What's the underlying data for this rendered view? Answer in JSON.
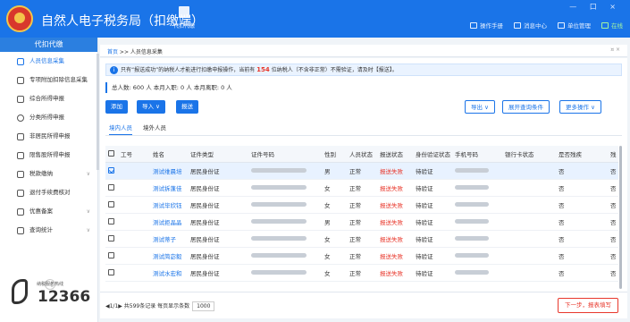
{
  "header": {
    "app_title": "自然人电子税务局（扣缴端）",
    "active_tab": "代扣代缴",
    "tools": [
      "操作手册",
      "消息中心",
      "单位管理",
      "在线"
    ],
    "window_controls": "— 口 ×"
  },
  "sidebar": {
    "header": "代扣代缴",
    "items": [
      {
        "label": "人员信息采集",
        "icon": "person-icon",
        "active": true,
        "chevron": ""
      },
      {
        "label": "专项附加扣除信息采集",
        "icon": "grid-icon",
        "active": false,
        "chevron": ""
      },
      {
        "label": "综合所得申报",
        "icon": "layers-icon",
        "active": false,
        "chevron": ""
      },
      {
        "label": "分类所得申报",
        "icon": "clock-icon",
        "active": false,
        "chevron": ""
      },
      {
        "label": "非居民所得申报",
        "icon": "user-icon",
        "active": false,
        "chevron": ""
      },
      {
        "label": "限售股所得申报",
        "icon": "bar-chart-icon",
        "active": false,
        "chevron": ""
      },
      {
        "label": "税款缴纳",
        "icon": "folder-icon",
        "active": false,
        "chevron": "∨"
      },
      {
        "label": "退付手续费核对",
        "icon": "table-icon",
        "active": false,
        "chevron": ""
      },
      {
        "label": "优惠备案",
        "icon": "file-icon",
        "active": false,
        "chevron": "∨"
      },
      {
        "label": "查询统计",
        "icon": "search-list-icon",
        "active": false,
        "chevron": "∨"
      }
    ],
    "collapse": "《",
    "hotline_title": "纳税服务热线",
    "hotline_number": "12366"
  },
  "tabbar": {
    "home": "首页",
    "sep": " >> ",
    "current": "人员信息采集",
    "close": "¤ ×"
  },
  "notice": {
    "icon": "i",
    "prefix": "只有“报送成功”的纳税人才能进行扣缴申报操作，当前有",
    "count": "154",
    "suffix": "位纳税人（不含非正常）不需验证，请及时【报送】。"
  },
  "stats": "总人数: 600 人   本月入职: 0 人   本月离职: 0 人",
  "buttons": {
    "add": "添加",
    "import": "导入 ∨",
    "submit": "报送",
    "export": "导出 ∨",
    "open_query": "展开查询条件",
    "more": "更多操作 ∨"
  },
  "subtabs": [
    "境内人员",
    "境外人员"
  ],
  "table": {
    "columns": [
      "",
      "工号",
      "姓名",
      "证件类型",
      "证件号码",
      "性别",
      "人员状态",
      "报送状态",
      "身份验证状态",
      "手机号码",
      "银行卡状态",
      "是否残疾",
      "残"
    ],
    "rows": [
      {
        "selected": true,
        "name": "测试维晨培",
        "id_type": "居民身份证",
        "gender": "男",
        "status": "正常",
        "submit": "报送失败",
        "verify": "待验证",
        "disabled": "否",
        "last": "否"
      },
      {
        "selected": false,
        "name": "测试拆蓬佳",
        "id_type": "居民身份证",
        "gender": "女",
        "status": "正常",
        "submit": "报送失败",
        "verify": "待验证",
        "disabled": "否",
        "last": "否"
      },
      {
        "selected": false,
        "name": "测试毕欣钰",
        "id_type": "居民身份证",
        "gender": "女",
        "status": "正常",
        "submit": "报送失败",
        "verify": "待验证",
        "disabled": "否",
        "last": "否"
      },
      {
        "selected": false,
        "name": "测试拒晶晶",
        "id_type": "居民身份证",
        "gender": "男",
        "status": "正常",
        "submit": "报送失败",
        "verify": "待验证",
        "disabled": "否",
        "last": "否"
      },
      {
        "selected": false,
        "name": "测试蒂子",
        "id_type": "居民身份证",
        "gender": "女",
        "status": "正常",
        "submit": "报送失败",
        "verify": "待验证",
        "disabled": "否",
        "last": "否"
      },
      {
        "selected": false,
        "name": "测试简宓毅",
        "id_type": "居民身份证",
        "gender": "女",
        "status": "正常",
        "submit": "报送失败",
        "verify": "待验证",
        "disabled": "否",
        "last": "否"
      },
      {
        "selected": false,
        "name": "测试水宏和",
        "id_type": "居民身份证",
        "gender": "女",
        "status": "正常",
        "submit": "报送失败",
        "verify": "待验证",
        "disabled": "否",
        "last": "否"
      }
    ]
  },
  "footer": {
    "pager": "◀1/1▶ 共599条记录  每页显示条数",
    "page_size": "1000",
    "next": "下一步，报表填写"
  }
}
